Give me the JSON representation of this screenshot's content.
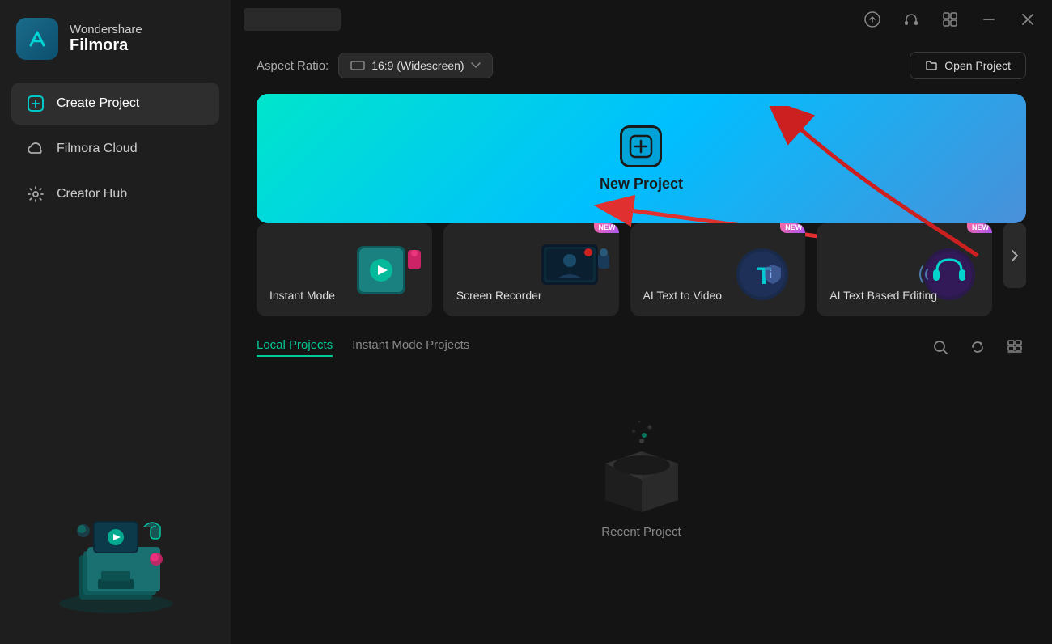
{
  "app": {
    "name_line1": "Wondershare",
    "name_line2": "Filmora"
  },
  "titlebar": {
    "upload_icon": "⬆",
    "headset_icon": "🎧",
    "grid_icon": "⊞",
    "minimize_icon": "—",
    "close_icon": "✕"
  },
  "sidebar": {
    "items": [
      {
        "id": "create-project",
        "label": "Create Project",
        "active": true
      },
      {
        "id": "filmora-cloud",
        "label": "Filmora Cloud",
        "active": false
      },
      {
        "id": "creator-hub",
        "label": "Creator Hub",
        "active": false
      }
    ]
  },
  "main": {
    "aspect_ratio_label": "Aspect Ratio:",
    "aspect_ratio_value": "16:9 (Widescreen)",
    "open_project_label": "Open Project",
    "new_project_label": "New Project",
    "tabs": [
      {
        "id": "local-projects",
        "label": "Local Projects",
        "active": true
      },
      {
        "id": "instant-mode-projects",
        "label": "Instant Mode Projects",
        "active": false
      }
    ],
    "feature_cards": [
      {
        "id": "instant-mode",
        "label": "Instant Mode",
        "new_badge": false
      },
      {
        "id": "screen-recorder",
        "label": "Screen Recorder",
        "new_badge": true
      },
      {
        "id": "ai-text-to-video",
        "label": "AI Text to Video",
        "new_badge": true
      },
      {
        "id": "ai-text-based-editing",
        "label": "AI Text Based Editing",
        "new_badge": true
      }
    ],
    "empty_state_label": "Recent Project",
    "new_badge_text": "NEW"
  },
  "colors": {
    "accent_green": "#00c896",
    "accent_teal": "#00e5cc",
    "accent_blue": "#4a90d9",
    "red_arrow": "#e03030",
    "sidebar_bg": "#1e1e1e",
    "card_bg": "#252525"
  }
}
